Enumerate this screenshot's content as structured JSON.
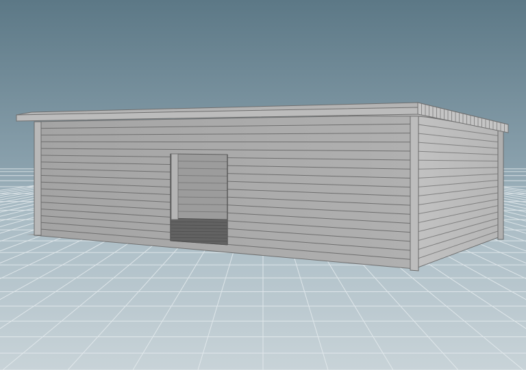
{
  "viewport": {
    "background_top_color": "#5f7a89",
    "background_horizon_color": "#9fb4be",
    "floor_color": "#c3cfd5",
    "grid_line_color": "#e3eaed",
    "grid_axis_color": "#f4f7f8"
  },
  "model": {
    "object": "log-cabin",
    "wall_color": "#a9a9a9",
    "wall_side_color": "#bcbcbc",
    "plank_line_color": "#6f6f6f",
    "roof_color": "#b2b2b2",
    "opening_interior_color": "#8a8a8a",
    "opening_floor_color": "#5c5c5c"
  }
}
